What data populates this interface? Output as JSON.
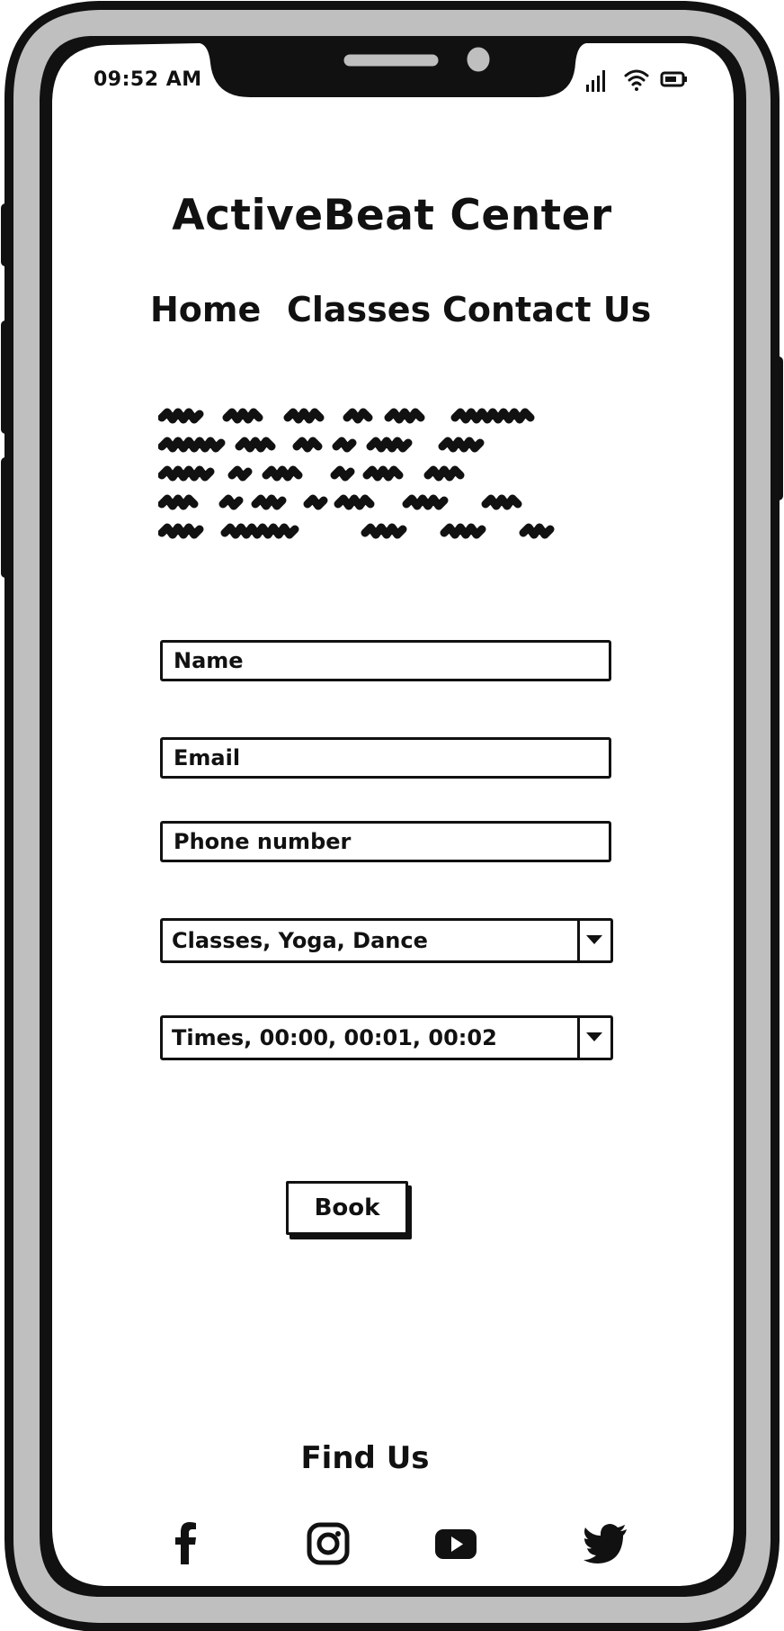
{
  "status_bar": {
    "time": "09:52 AM",
    "icons": [
      "signal-icon",
      "wifi-icon",
      "battery-icon"
    ]
  },
  "header": {
    "title": "ActiveBeat Center"
  },
  "nav": {
    "items": [
      {
        "label": "Home"
      },
      {
        "label": "Classes"
      },
      {
        "label": "Contact Us"
      }
    ]
  },
  "intro": {
    "placeholder_lines": 5
  },
  "form": {
    "name_placeholder": "Name",
    "email_placeholder": "Email",
    "phone_placeholder": "Phone number",
    "classes_select": {
      "selected": "Classes, Yoga, Dance"
    },
    "times_select": {
      "selected": "Times, 00:00, 00:01, 00:02"
    },
    "book_label": "Book"
  },
  "footer": {
    "find_us_label": "Find Us",
    "social_icons": [
      "facebook-icon",
      "instagram-icon",
      "youtube-icon",
      "twitter-icon"
    ]
  },
  "colors": {
    "frame": "#bfbfbf",
    "ink": "#111111",
    "screen": "#ffffff"
  }
}
